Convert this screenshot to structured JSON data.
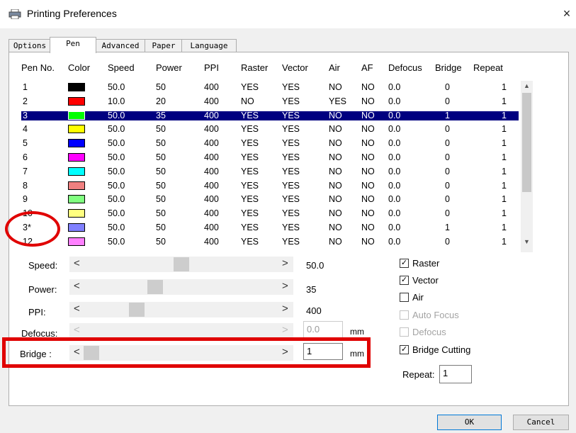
{
  "window": {
    "title": "Printing Preferences",
    "close_glyph": "×"
  },
  "tabs": [
    {
      "label": "Options",
      "active": false
    },
    {
      "label": "Pen",
      "active": true
    },
    {
      "label": "Advanced",
      "active": false
    },
    {
      "label": "Paper",
      "active": false
    },
    {
      "label": "Language",
      "active": false
    }
  ],
  "table": {
    "columns": [
      "Pen No.",
      "Color",
      "Speed",
      "Power",
      "PPI",
      "Raster",
      "Vector",
      "Air",
      "AF",
      "Defocus",
      "Bridge",
      "Repeat"
    ],
    "selected_index": 2,
    "rows": [
      {
        "pen": "1",
        "color": "#000000",
        "speed": "50.0",
        "power": "50",
        "ppi": "400",
        "raster": "YES",
        "vector": "YES",
        "air": "NO",
        "af": "NO",
        "defocus": "0.0",
        "bridge": "0",
        "repeat": "1"
      },
      {
        "pen": "2",
        "color": "#ff0000",
        "speed": "10.0",
        "power": "20",
        "ppi": "400",
        "raster": "NO",
        "vector": "YES",
        "air": "YES",
        "af": "NO",
        "defocus": "0.0",
        "bridge": "0",
        "repeat": "1"
      },
      {
        "pen": "3",
        "color": "#00ff00",
        "speed": "50.0",
        "power": "35",
        "ppi": "400",
        "raster": "YES",
        "vector": "YES",
        "air": "NO",
        "af": "NO",
        "defocus": "0.0",
        "bridge": "1",
        "repeat": "1"
      },
      {
        "pen": "4",
        "color": "#ffff00",
        "speed": "50.0",
        "power": "50",
        "ppi": "400",
        "raster": "YES",
        "vector": "YES",
        "air": "NO",
        "af": "NO",
        "defocus": "0.0",
        "bridge": "0",
        "repeat": "1"
      },
      {
        "pen": "5",
        "color": "#0000ff",
        "speed": "50.0",
        "power": "50",
        "ppi": "400",
        "raster": "YES",
        "vector": "YES",
        "air": "NO",
        "af": "NO",
        "defocus": "0.0",
        "bridge": "0",
        "repeat": "1"
      },
      {
        "pen": "6",
        "color": "#ff00ff",
        "speed": "50.0",
        "power": "50",
        "ppi": "400",
        "raster": "YES",
        "vector": "YES",
        "air": "NO",
        "af": "NO",
        "defocus": "0.0",
        "bridge": "0",
        "repeat": "1"
      },
      {
        "pen": "7",
        "color": "#00ffff",
        "speed": "50.0",
        "power": "50",
        "ppi": "400",
        "raster": "YES",
        "vector": "YES",
        "air": "NO",
        "af": "NO",
        "defocus": "0.0",
        "bridge": "0",
        "repeat": "1"
      },
      {
        "pen": "8",
        "color": "#f08080",
        "speed": "50.0",
        "power": "50",
        "ppi": "400",
        "raster": "YES",
        "vector": "YES",
        "air": "NO",
        "af": "NO",
        "defocus": "0.0",
        "bridge": "0",
        "repeat": "1"
      },
      {
        "pen": "9",
        "color": "#80ff80",
        "speed": "50.0",
        "power": "50",
        "ppi": "400",
        "raster": "YES",
        "vector": "YES",
        "air": "NO",
        "af": "NO",
        "defocus": "0.0",
        "bridge": "0",
        "repeat": "1"
      },
      {
        "pen": "10",
        "color": "#ffff80",
        "speed": "50.0",
        "power": "50",
        "ppi": "400",
        "raster": "YES",
        "vector": "YES",
        "air": "NO",
        "af": "NO",
        "defocus": "0.0",
        "bridge": "0",
        "repeat": "1"
      },
      {
        "pen": "3*",
        "color": "#8080ff",
        "speed": "50.0",
        "power": "50",
        "ppi": "400",
        "raster": "YES",
        "vector": "YES",
        "air": "NO",
        "af": "NO",
        "defocus": "0.0",
        "bridge": "1",
        "repeat": "1"
      },
      {
        "pen": "12",
        "color": "#ff80ff",
        "speed": "50.0",
        "power": "50",
        "ppi": "400",
        "raster": "YES",
        "vector": "YES",
        "air": "NO",
        "af": "NO",
        "defocus": "0.0",
        "bridge": "0",
        "repeat": "1"
      }
    ]
  },
  "sliders": {
    "speed": {
      "label": "Speed:",
      "value": "50.0",
      "position": 0.5,
      "enabled": true
    },
    "power": {
      "label": "Power:",
      "value": "35",
      "position": 0.35,
      "enabled": true
    },
    "ppi": {
      "label": "PPI:",
      "value": "400",
      "position": 0.25,
      "enabled": true
    },
    "defocus": {
      "label": "Defocus:",
      "value": "0.0",
      "unit": "mm",
      "enabled": false
    },
    "bridge": {
      "label": "Bridge :",
      "value": "1",
      "unit": "mm",
      "position": 0.0,
      "enabled": true
    }
  },
  "options": [
    {
      "label": "Raster",
      "checked": true,
      "enabled": true
    },
    {
      "label": "Vector",
      "checked": true,
      "enabled": true
    },
    {
      "label": "Air",
      "checked": false,
      "enabled": true
    },
    {
      "label": "Auto Focus",
      "checked": false,
      "enabled": false
    },
    {
      "label": "Defocus",
      "checked": false,
      "enabled": false
    },
    {
      "label": "Bridge Cutting",
      "checked": true,
      "enabled": true
    }
  ],
  "repeat": {
    "label": "Repeat:",
    "value": "1"
  },
  "buttons": {
    "ok": "OK",
    "cancel": "Cancel"
  },
  "icons": {
    "title_icon": "printer-icon",
    "close_icon": "close-icon",
    "check": "check-icon"
  },
  "annotation_color": "#e00000",
  "selection_color": "#000080"
}
